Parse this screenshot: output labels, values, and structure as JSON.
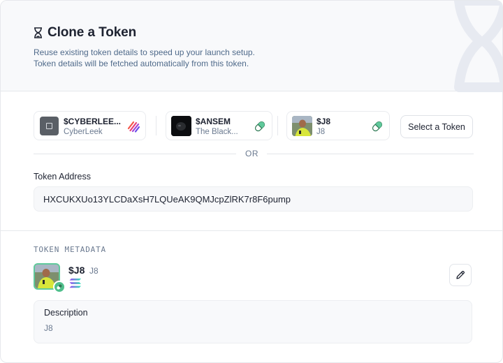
{
  "header": {
    "title": "Clone a Token",
    "subtitle_line1": "Reuse existing token details to speed up your launch setup.",
    "subtitle_line2": "Token details will be fetched automatically from this token.",
    "title_icon": "hourglass-icon"
  },
  "tokens": [
    {
      "symbol": "$CYBERLEE...",
      "name": "CyberLeek",
      "badge": "stripes-icon"
    },
    {
      "symbol": "$ANSEM",
      "name": "The Black...",
      "badge": "pill-icon"
    },
    {
      "symbol": "$J8",
      "name": "J8",
      "badge": "pill-icon"
    }
  ],
  "select_button_label": "Select a Token",
  "or_label": "OR",
  "address": {
    "label": "Token Address",
    "value": "HXCUKXUo13YLCDaXsH7LQUeAK9QMJcpZlRK7r8F6pump"
  },
  "metadata": {
    "section_label": "TOKEN METADATA",
    "symbol": "$J8",
    "name": "J8",
    "chain_icon": "solana-icon",
    "description_label": "Description",
    "description_value": "J8"
  },
  "colors": {
    "accent_green": "#4fbf8c",
    "subtitle": "#4f6a8a",
    "muted": "#6b7a90"
  }
}
